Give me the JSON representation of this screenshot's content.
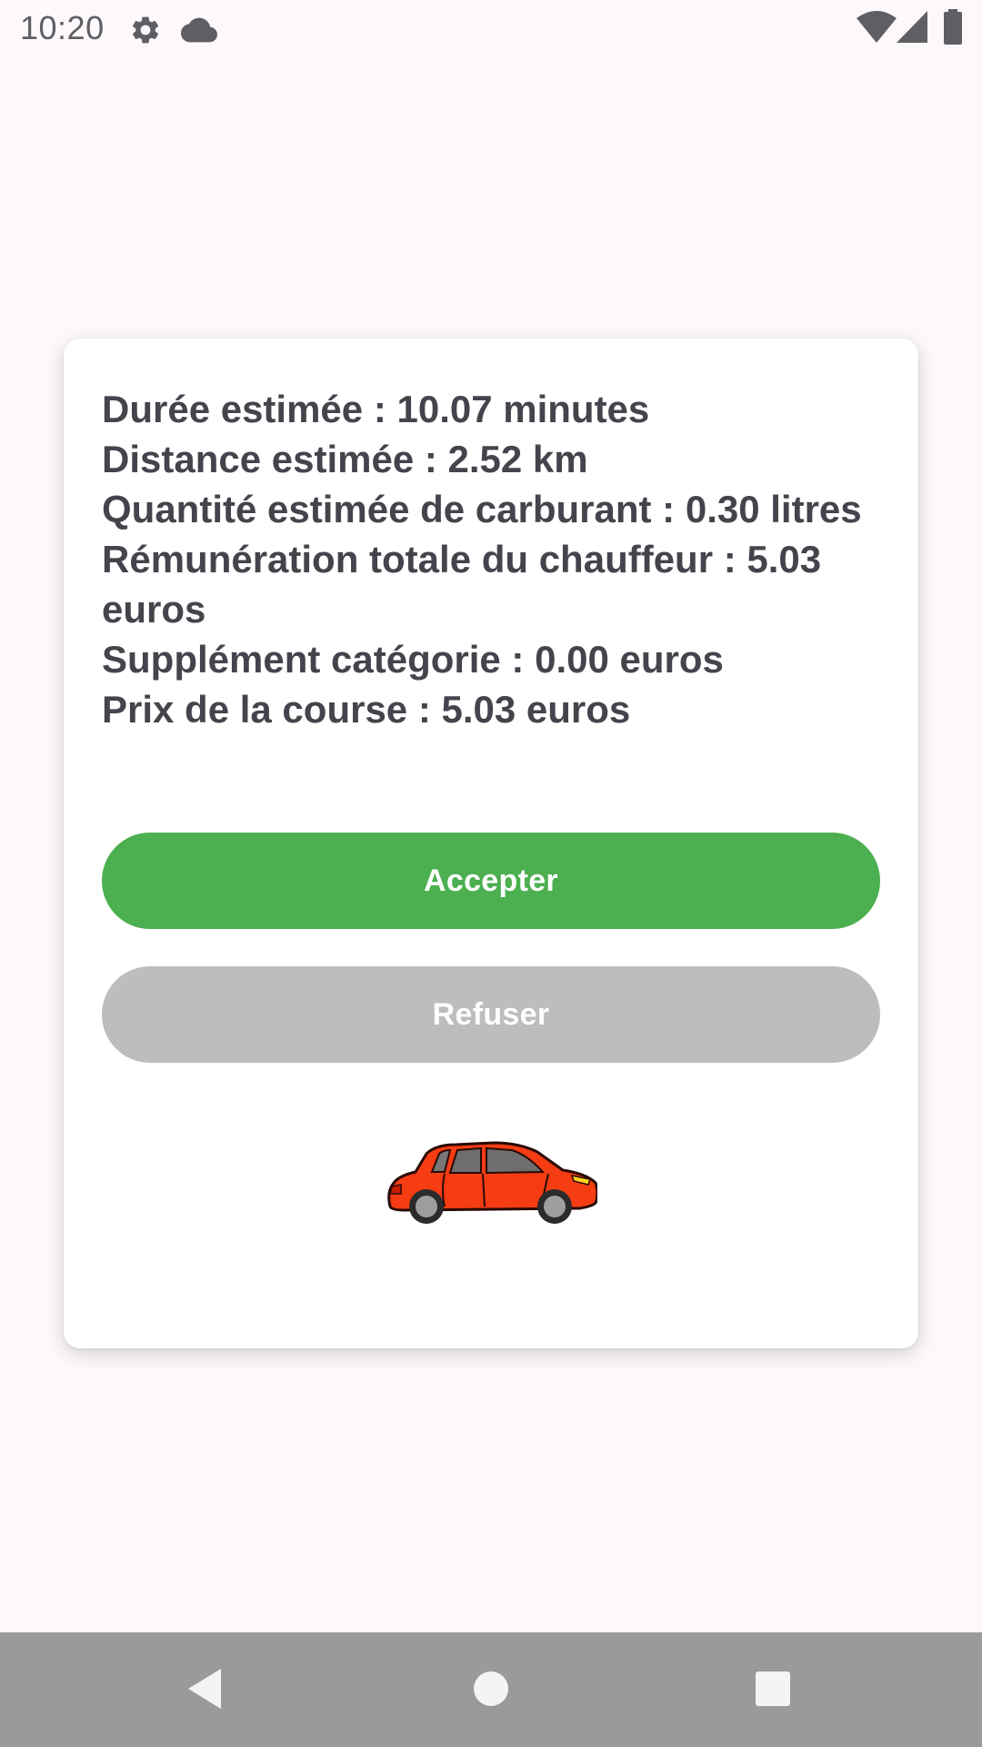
{
  "status_bar": {
    "time": "10:20",
    "icons": [
      "settings-icon",
      "cloud-icon",
      "wifi-icon",
      "signal-icon",
      "battery-icon"
    ]
  },
  "trip": {
    "lines": [
      "Durée estimée : 10.07 minutes",
      "Distance estimée : 2.52 km",
      "Quantité estimée de carburant : 0.30 litres",
      "Rémunération totale du chauffeur : 5.03 euros",
      "Supplément catégorie : 0.00 euros",
      "Prix de la course : 5.03 euros"
    ]
  },
  "actions": {
    "accept_label": "Accepter",
    "refuse_label": "Refuser"
  },
  "colors": {
    "accept": "#4caf50",
    "refuse": "#bdbdbd",
    "text": "#45444c",
    "background": "#fdf8fc",
    "nav_bar": "#9a9a9a",
    "car": "#f53c12"
  },
  "navigation": {
    "icons": [
      "back-icon",
      "home-icon",
      "recents-icon"
    ]
  }
}
